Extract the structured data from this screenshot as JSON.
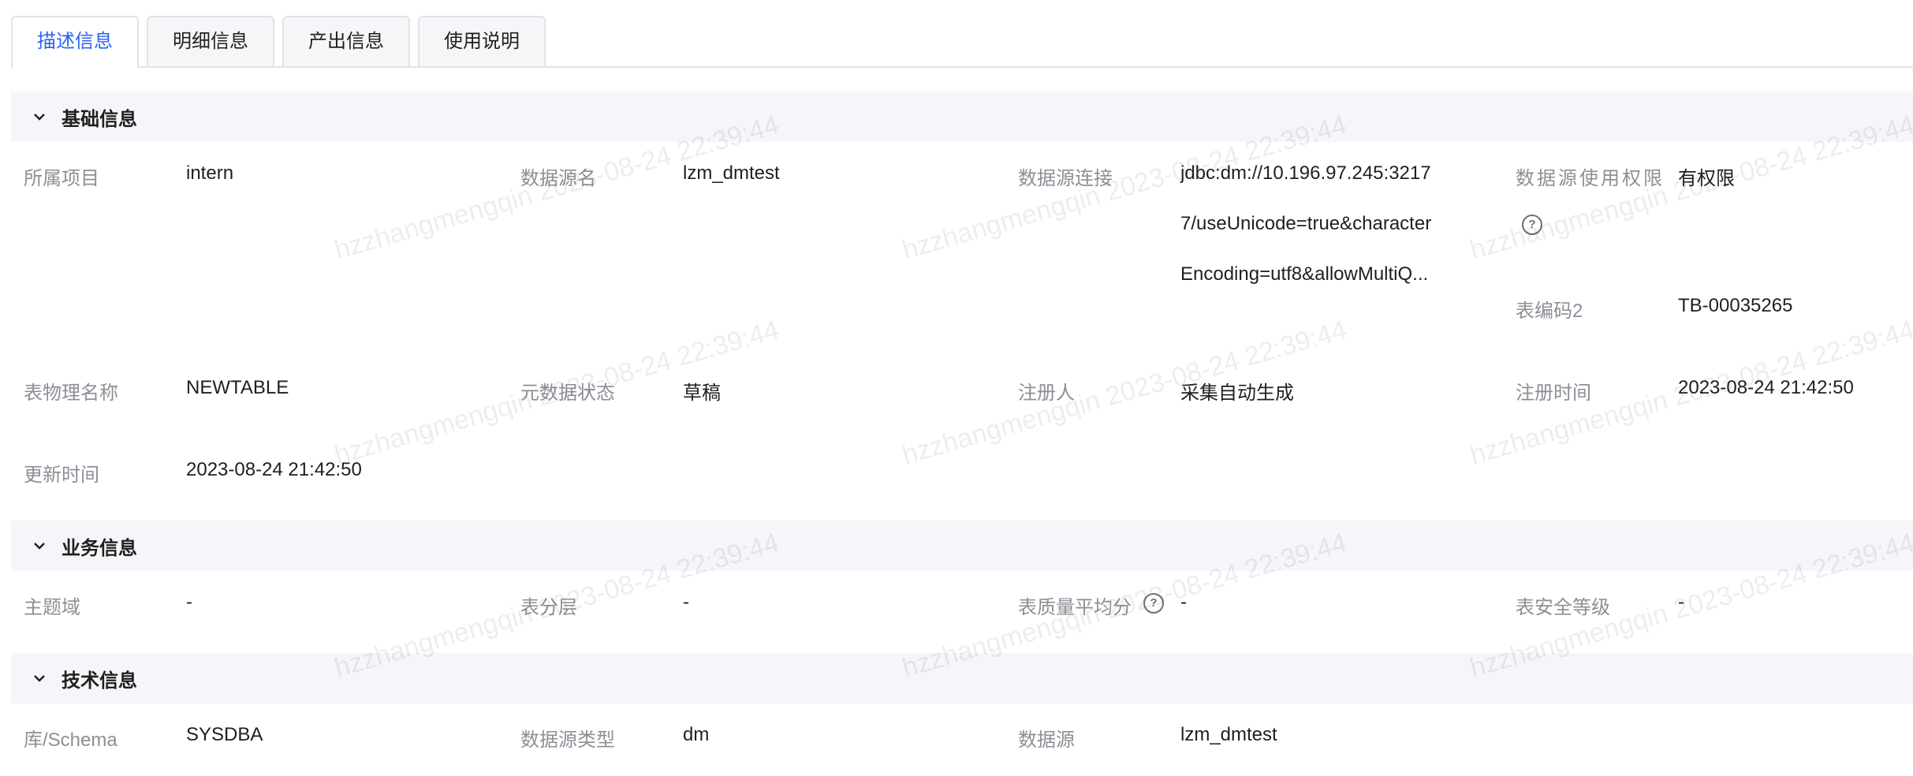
{
  "watermark": {
    "user": "hzzhangmengqin",
    "time": "2023-08-24 22:39:44"
  },
  "tabs": [
    {
      "label": "描述信息",
      "active": true
    },
    {
      "label": "明细信息",
      "active": false
    },
    {
      "label": "产出信息",
      "active": false
    },
    {
      "label": "使用说明",
      "active": false
    }
  ],
  "basic": {
    "title": "基础信息",
    "project_label": "所属项目",
    "project_value": "intern",
    "ds_name_label": "数据源名",
    "ds_name_value": "lzm_dmtest",
    "ds_conn_label": "数据源连接",
    "ds_conn_lines": [
      "jdbc:dm://10.196.97.245:3217",
      "7/useUnicode=true&character",
      "Encoding=utf8&allowMultiQ..."
    ],
    "ds_perm_label": "数据源使用权限",
    "ds_perm_value": "有权限",
    "table_code_label": "表编码2",
    "table_code_value": "TB-00035265",
    "phys_name_label": "表物理名称",
    "phys_name_value": "NEWTABLE",
    "meta_status_label": "元数据状态",
    "meta_status_value": "草稿",
    "registrant_label": "注册人",
    "registrant_value": "采集自动生成",
    "reg_time_label": "注册时间",
    "reg_time_value": "2023-08-24 21:42:50",
    "update_time_label": "更新时间",
    "update_time_value": "2023-08-24 21:42:50"
  },
  "business": {
    "title": "业务信息",
    "domain_label": "主题域",
    "domain_value": "-",
    "layer_label": "表分层",
    "layer_value": "-",
    "quality_label": "表质量平均分",
    "quality_value": "-",
    "security_label": "表安全等级",
    "security_value": "-"
  },
  "tech": {
    "title": "技术信息",
    "schema_label": "库/Schema",
    "schema_value": "SYSDBA",
    "ds_type_label": "数据源类型",
    "ds_type_value": "dm",
    "ds_label": "数据源",
    "ds_value": "lzm_dmtest"
  },
  "colors": {
    "accent": "#2a62f0",
    "label": "#8c8f96",
    "section_bg": "#f5f6f9"
  },
  "icons": {
    "collapse": "chevron-down-icon",
    "help": "question-circle-icon"
  }
}
